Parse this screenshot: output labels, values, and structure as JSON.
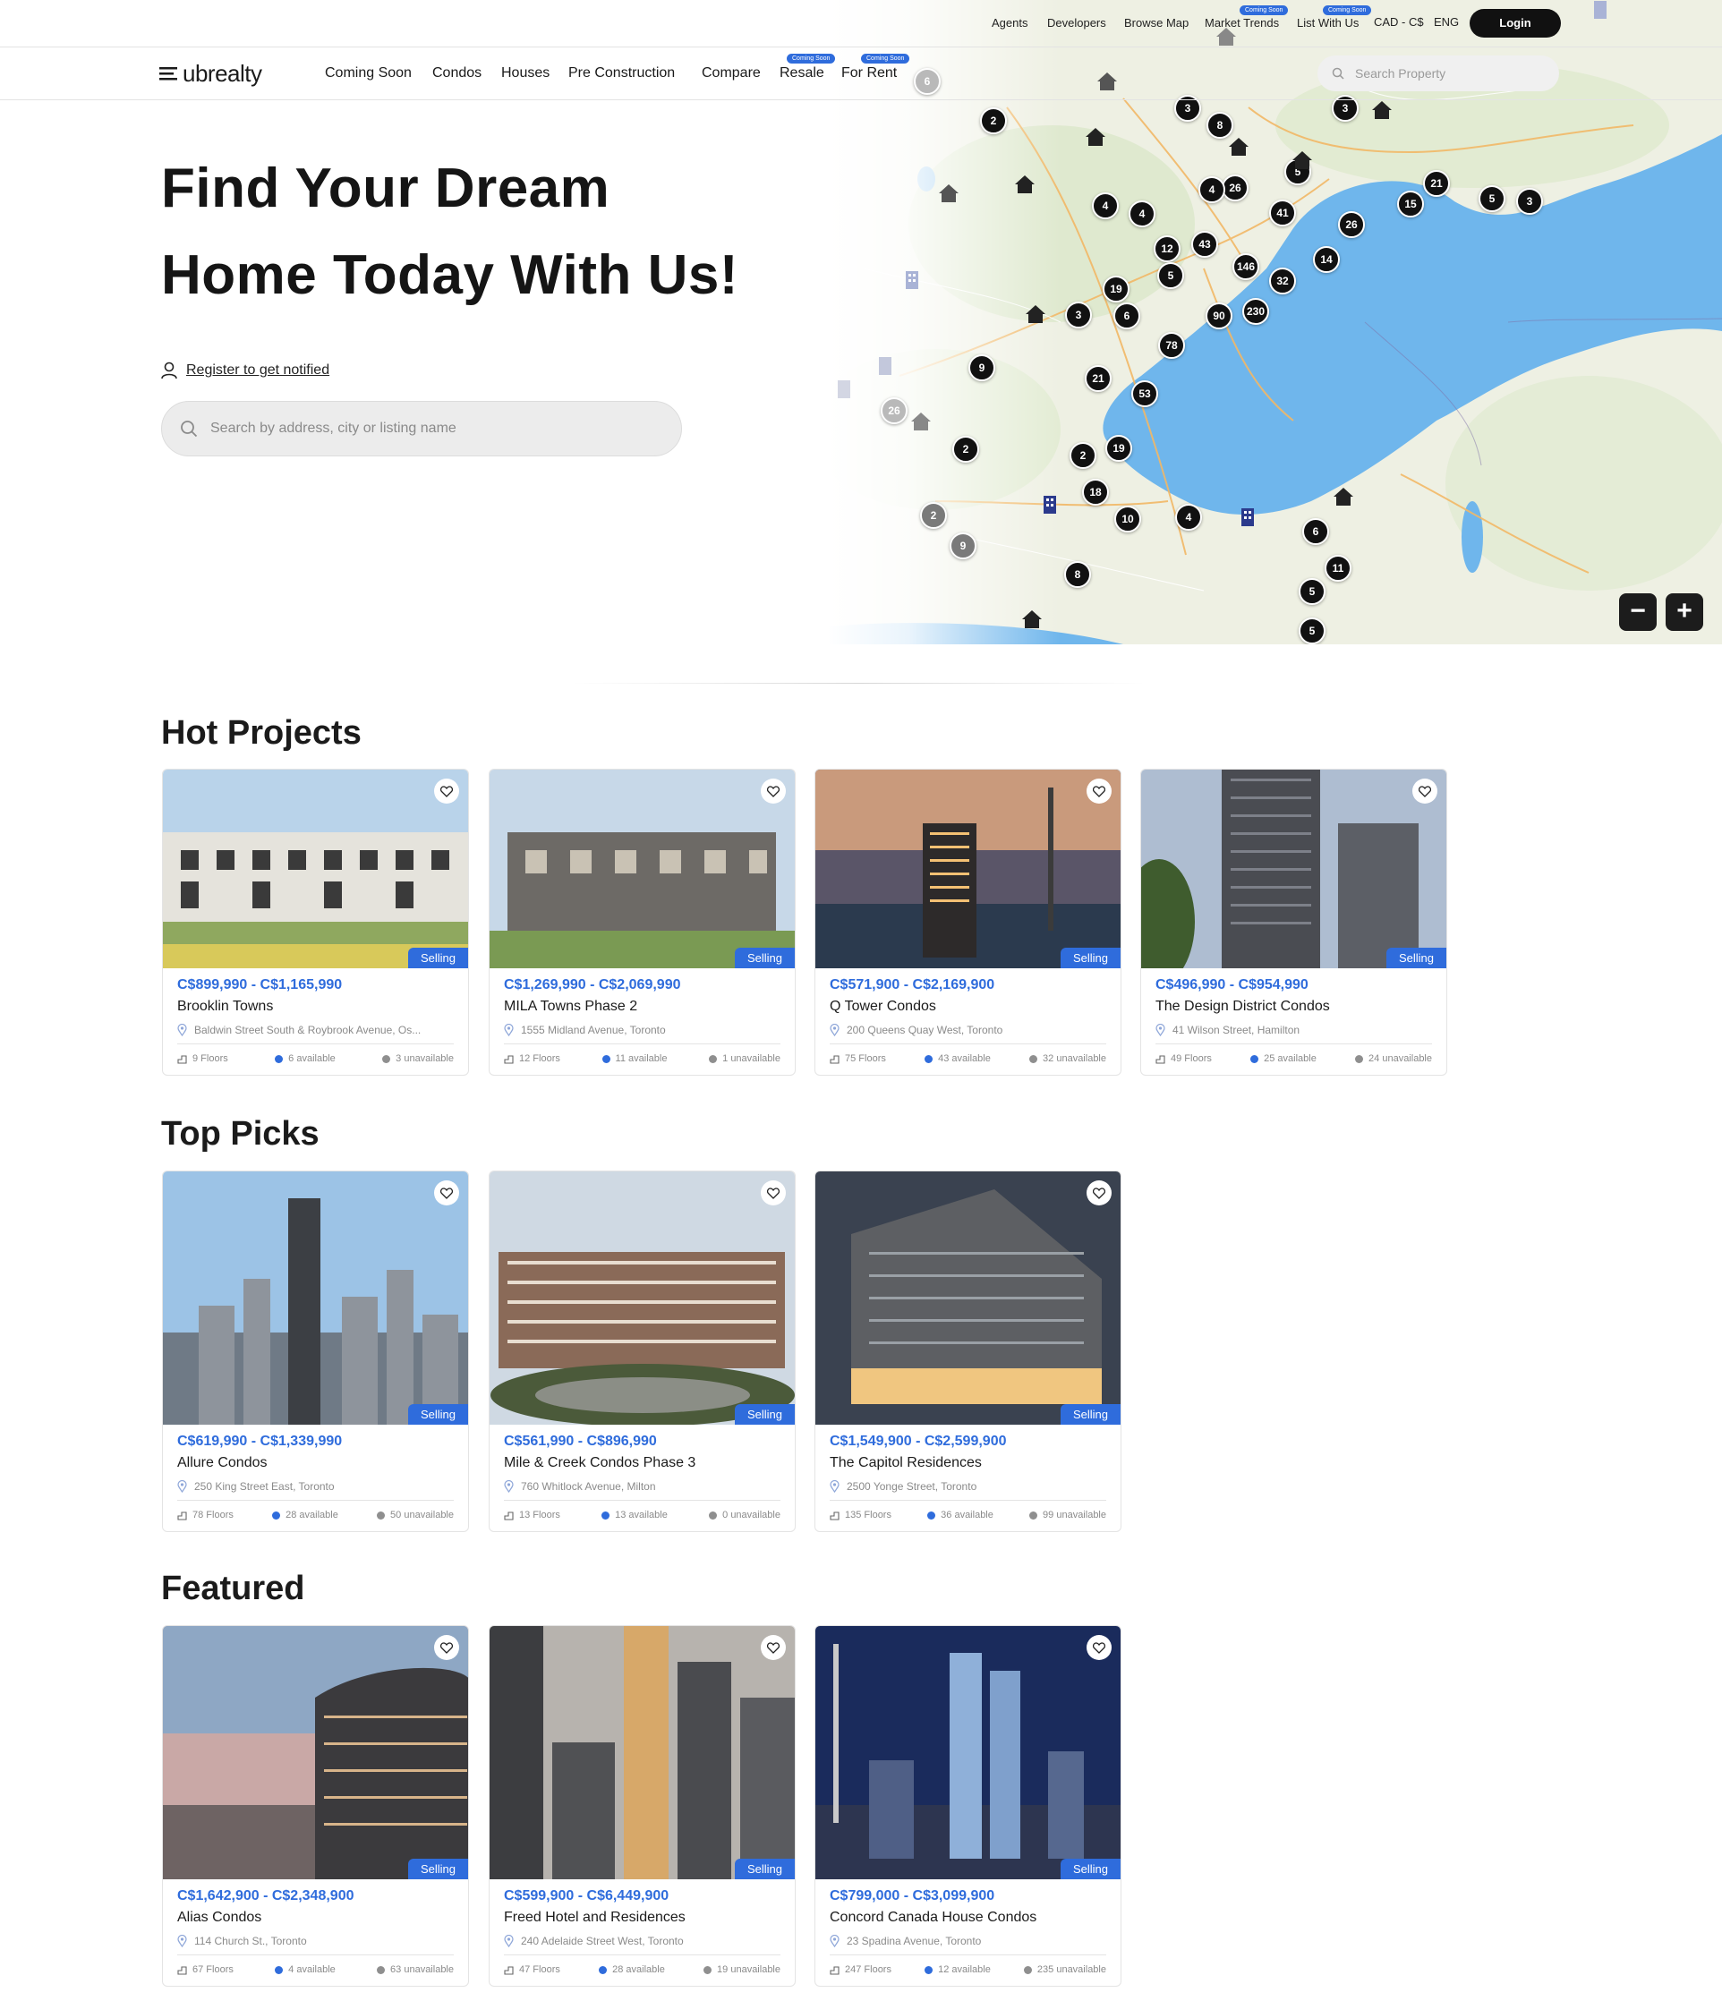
{
  "topbar": {
    "links": [
      "Agents",
      "Developers",
      "Browse Map",
      "Market Trends",
      "List With Us",
      "CAD - C$",
      "ENG"
    ],
    "badges": [
      "Coming Soon",
      "Coming Soon"
    ],
    "login": "Login"
  },
  "nav": {
    "logo": "ubrealty",
    "items": [
      "Coming Soon",
      "Condos",
      "Houses",
      "Pre Construction",
      "Compare",
      "Resale",
      "For Rent"
    ],
    "item_badges": [
      "Coming Soon",
      "Coming Soon"
    ],
    "search_placeholder": "Search Property"
  },
  "hero": {
    "title_line1": "Find Your Dream",
    "title_line2": "Home Today With Us!",
    "register": "Register to get notified",
    "search_placeholder": "Search by address, city or listing name"
  },
  "map": {
    "clusters": [
      "2",
      "3",
      "8",
      "3",
      "4",
      "4",
      "26",
      "5",
      "21",
      "15",
      "5",
      "3",
      "4",
      "41",
      "26",
      "12",
      "43",
      "5",
      "146",
      "14",
      "19",
      "3",
      "6",
      "32",
      "90",
      "230",
      "78",
      "9",
      "21",
      "53",
      "2",
      "19",
      "18",
      "2",
      "10",
      "4",
      "6",
      "11",
      "2",
      "9",
      "8",
      "5",
      "5",
      "26",
      "6"
    ]
  },
  "hot_projects": {
    "title": "Hot Projects",
    "cards": [
      {
        "price": "C$899,990 - C$1,165,990",
        "name": "Brooklin Towns",
        "address": "Baldwin Street South & Roybrook Avenue, Os...",
        "floors": "9 Floors",
        "available": "6 available",
        "unavailable": "3 unavailable",
        "status": "Selling"
      },
      {
        "price": "C$1,269,990 - C$2,069,990",
        "name": "MILA Towns Phase 2",
        "address": "1555 Midland Avenue, Toronto",
        "floors": "12 Floors",
        "available": "11 available",
        "unavailable": "1 unavailable",
        "status": "Selling"
      },
      {
        "price": "C$571,900 - C$2,169,900",
        "name": "Q Tower Condos",
        "address": "200 Queens Quay West, Toronto",
        "floors": "75 Floors",
        "available": "43 available",
        "unavailable": "32 unavailable",
        "status": "Selling"
      },
      {
        "price": "C$496,990 - C$954,990",
        "name": "The Design District Condos",
        "address": "41 Wilson Street, Hamilton",
        "floors": "49 Floors",
        "available": "25 available",
        "unavailable": "24 unavailable",
        "status": "Selling"
      }
    ]
  },
  "top_picks": {
    "title": "Top Picks",
    "cards": [
      {
        "price": "C$619,990 - C$1,339,990",
        "name": "Allure Condos",
        "address": "250 King Street East, Toronto",
        "floors": "78 Floors",
        "available": "28 available",
        "unavailable": "50 unavailable",
        "status": "Selling"
      },
      {
        "price": "C$561,990 - C$896,990",
        "name": "Mile & Creek Condos Phase 3",
        "address": "760 Whitlock Avenue, Milton",
        "floors": "13 Floors",
        "available": "13 available",
        "unavailable": "0 unavailable",
        "status": "Selling"
      },
      {
        "price": "C$1,549,900 - C$2,599,900",
        "name": "The Capitol Residences",
        "address": "2500 Yonge Street, Toronto",
        "floors": "135 Floors",
        "available": "36 available",
        "unavailable": "99 unavailable",
        "status": "Selling"
      }
    ]
  },
  "featured": {
    "title": "Featured",
    "cards": [
      {
        "price": "C$1,642,900 - C$2,348,900",
        "name": "Alias Condos",
        "address": "114 Church St., Toronto",
        "floors": "67 Floors",
        "available": "4 available",
        "unavailable": "63 unavailable",
        "status": "Selling"
      },
      {
        "price": "C$599,900 - C$6,449,900",
        "name": "Freed Hotel and Residences",
        "address": "240 Adelaide Street West, Toronto",
        "floors": "47 Floors",
        "available": "28 available",
        "unavailable": "19 unavailable",
        "status": "Selling"
      },
      {
        "price": "C$799,000 - C$3,099,900",
        "name": "Concord Canada House Condos",
        "address": "23 Spadina Avenue, Toronto",
        "floors": "247 Floors",
        "available": "12 available",
        "unavailable": "235 unavailable",
        "status": "Selling"
      }
    ]
  },
  "colors": {
    "accent": "#2f6cdc",
    "lake": "#6fb6ec",
    "dark": "#111111"
  },
  "icons": [
    "menu-logo-icon",
    "search-icon",
    "user-icon",
    "heart-icon",
    "location-pin-icon",
    "floors-icon",
    "house-pin-icon",
    "building-pin-icon",
    "zoom-in-icon",
    "zoom-out-icon"
  ]
}
